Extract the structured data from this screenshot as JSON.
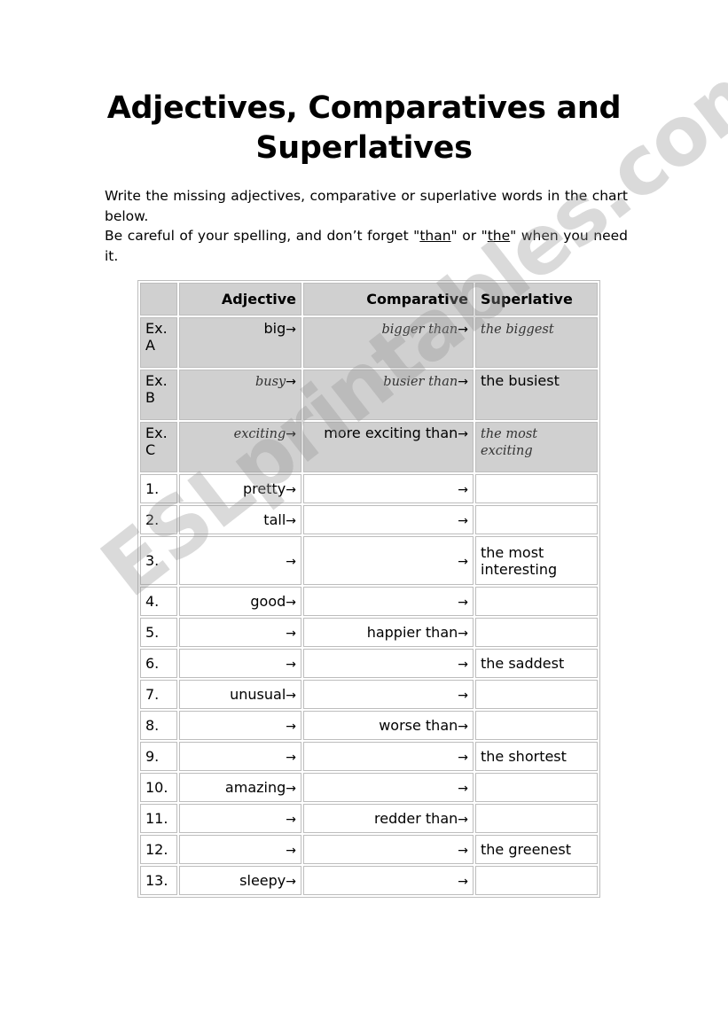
{
  "title": "Adjectives, Comparatives and Superlatives",
  "instructions": {
    "line1": "Write the missing adjectives, comparative or superlative words in the chart below.",
    "line2_a": "Be careful of your spelling, and don’t forget \"",
    "than": "than",
    "line2_b": "\" or \"",
    "the": "the",
    "line2_c": "\" when you need it."
  },
  "watermark": "ESLprintables.com",
  "arrow": "→",
  "table": {
    "headers": [
      "",
      "Adjective",
      "Comparative",
      "Superlative"
    ],
    "examples": [
      {
        "num": "Ex. A",
        "adjective": "big",
        "adj_hand": false,
        "comparative": "bigger than",
        "comp_hand": true,
        "superlative": "the biggest",
        "sup_hand": true
      },
      {
        "num": "Ex. B",
        "adjective": "busy",
        "adj_hand": true,
        "comparative": "busier than",
        "comp_hand": true,
        "superlative": "the busiest",
        "sup_hand": false
      },
      {
        "num": "Ex. C",
        "adjective": "exciting",
        "adj_hand": true,
        "comparative": "more exciting than",
        "comp_hand": false,
        "superlative": "the most exciting",
        "sup_hand": true
      }
    ],
    "rows": [
      {
        "num": "1.",
        "adjective": "pretty",
        "comparative": "",
        "superlative": ""
      },
      {
        "num": "2.",
        "adjective": "tall",
        "comparative": "",
        "superlative": ""
      },
      {
        "num": "3.",
        "adjective": "",
        "comparative": "",
        "superlative": "the most interesting"
      },
      {
        "num": "4.",
        "adjective": "good",
        "comparative": "",
        "superlative": ""
      },
      {
        "num": "5.",
        "adjective": "",
        "comparative": "happier than",
        "superlative": ""
      },
      {
        "num": "6.",
        "adjective": "",
        "comparative": "",
        "superlative": "the saddest"
      },
      {
        "num": "7.",
        "adjective": "unusual",
        "comparative": "",
        "superlative": ""
      },
      {
        "num": "8.",
        "adjective": "",
        "comparative": "worse than",
        "superlative": ""
      },
      {
        "num": "9.",
        "adjective": "",
        "comparative": "",
        "superlative": "the shortest"
      },
      {
        "num": "10.",
        "adjective": "amazing",
        "comparative": "",
        "superlative": ""
      },
      {
        "num": "11.",
        "adjective": "",
        "comparative": "redder than",
        "superlative": ""
      },
      {
        "num": "12.",
        "adjective": "",
        "comparative": "",
        "superlative": "the greenest"
      },
      {
        "num": "13.",
        "adjective": "sleepy",
        "comparative": "",
        "superlative": ""
      }
    ]
  }
}
